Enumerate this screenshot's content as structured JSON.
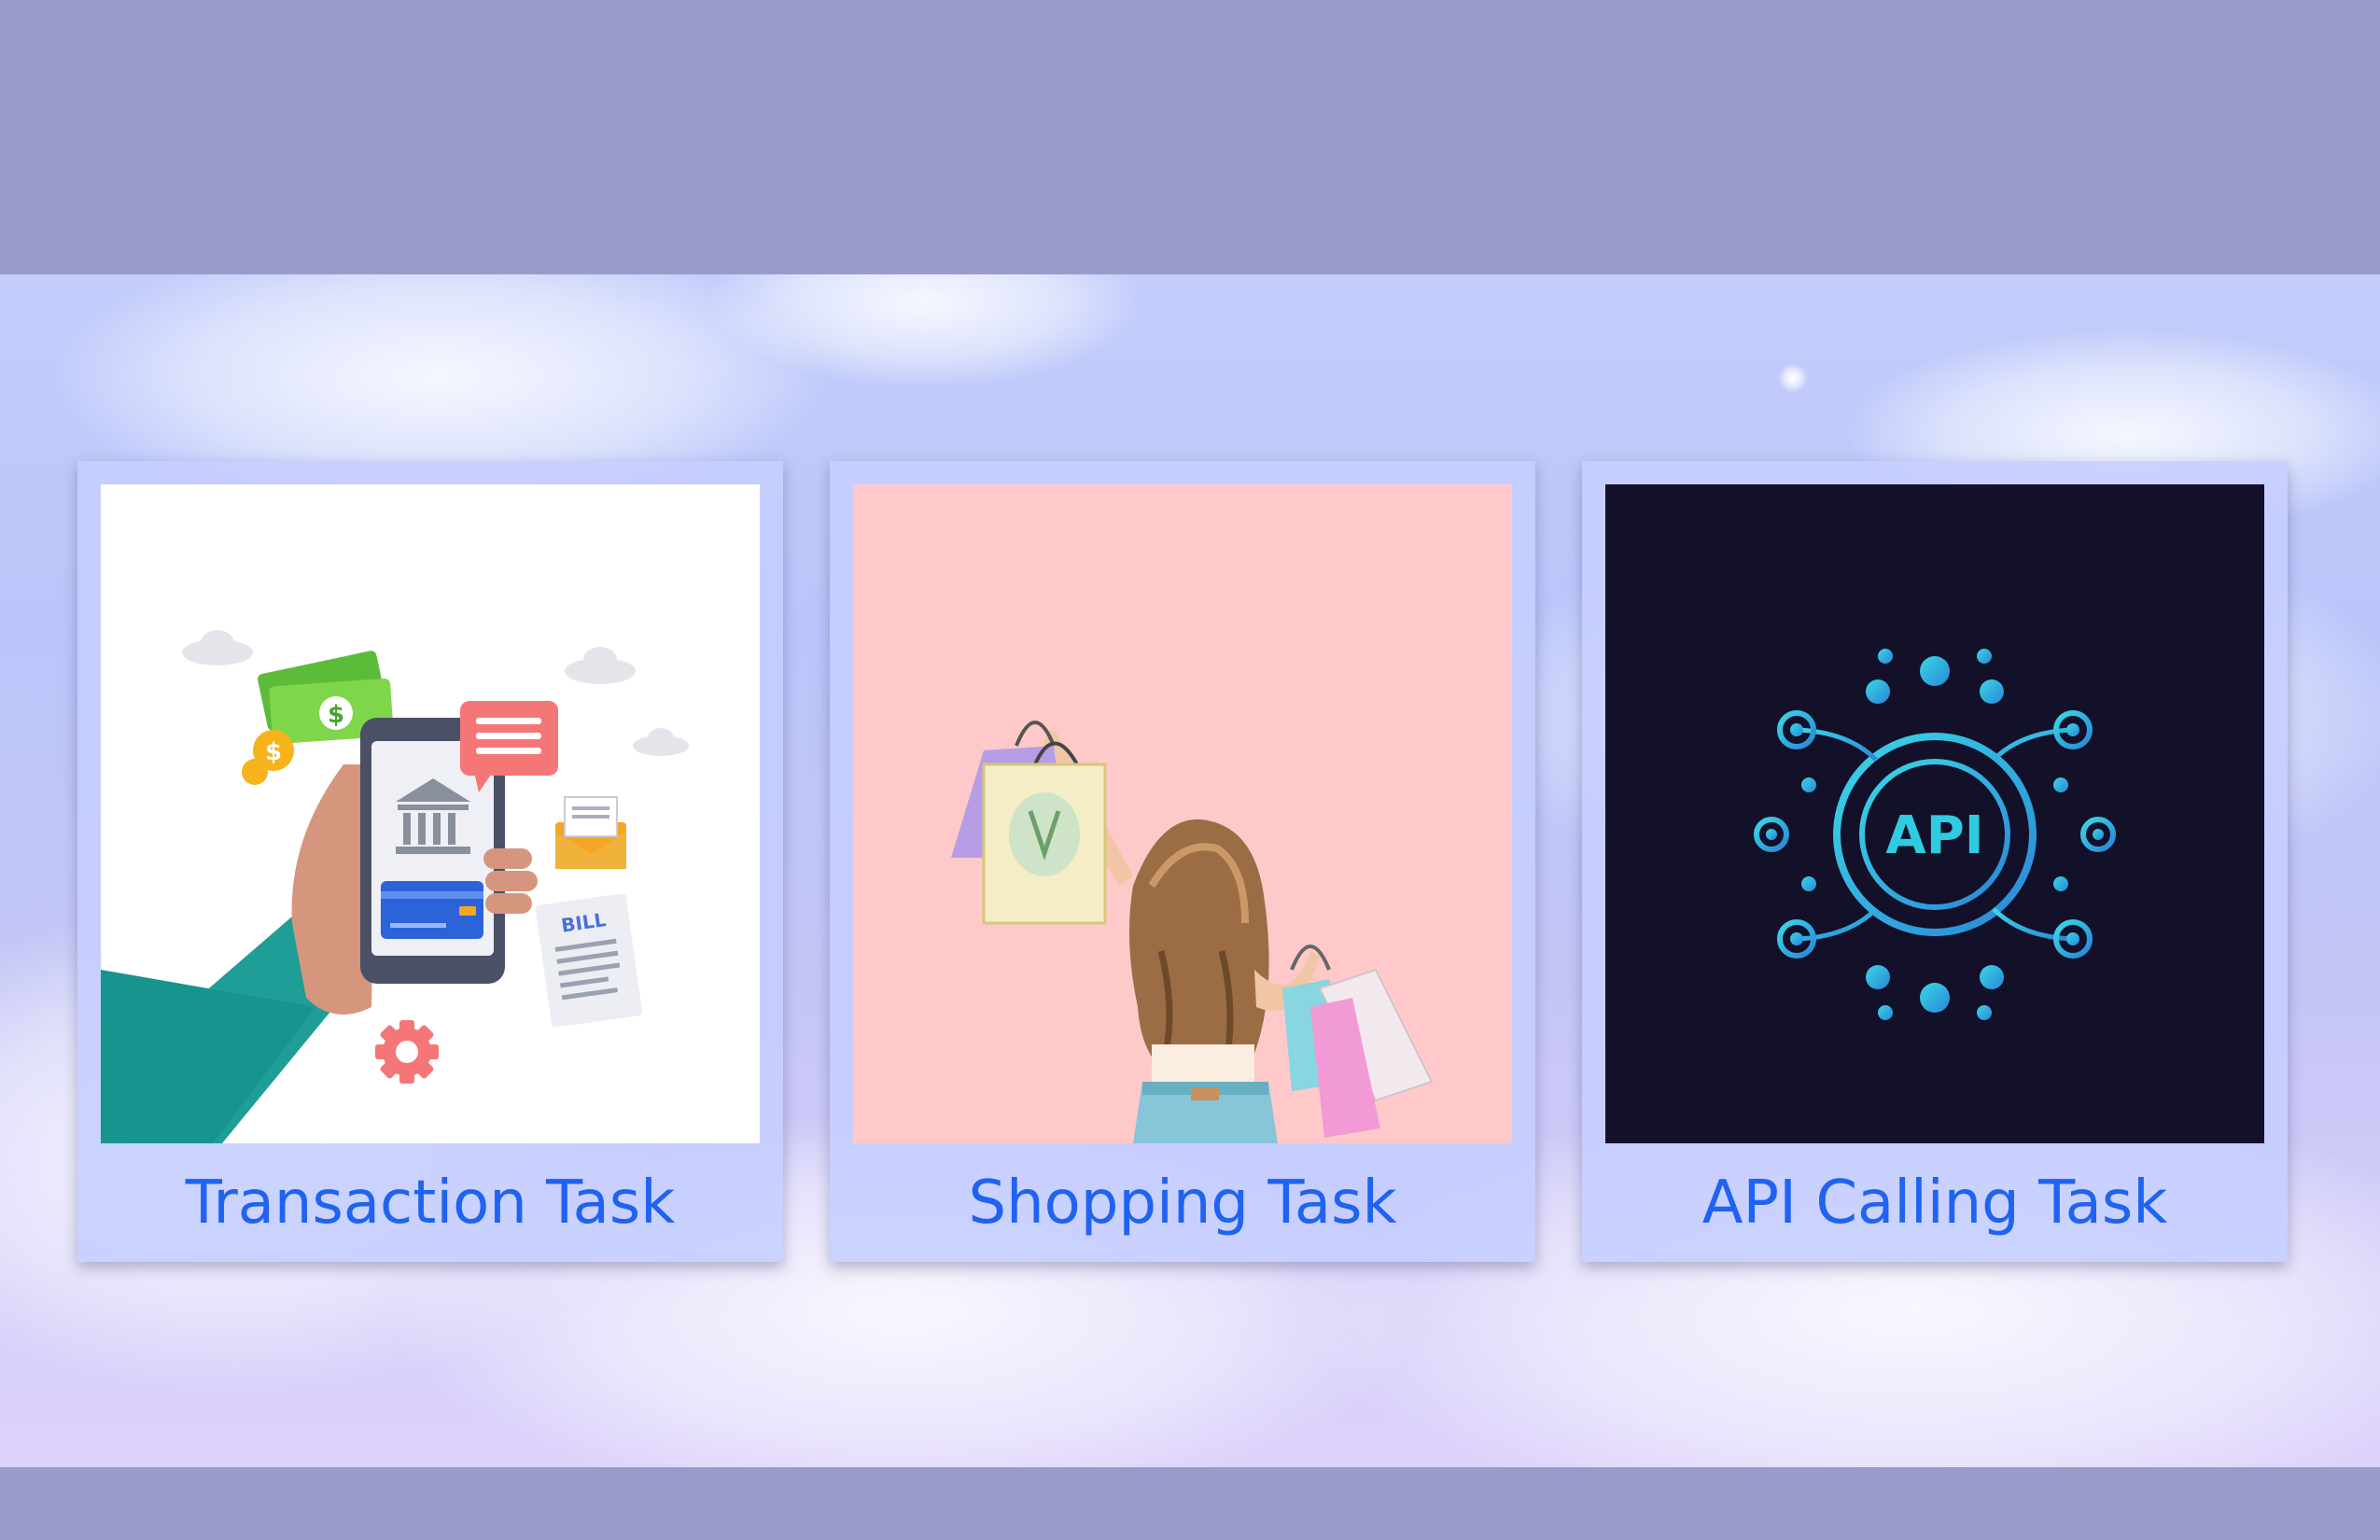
{
  "cards": [
    {
      "title": "Transaction Task",
      "image_icon": "mobile-banking-illustration",
      "image_text": "BILL"
    },
    {
      "title": "Shopping Task",
      "image_icon": "shopping-girl-illustration"
    },
    {
      "title": "API Calling Task",
      "image_icon": "api-network-illustration",
      "image_text": "API"
    }
  ],
  "colors": {
    "band": "#9a9acb",
    "card_title": "#1f63f0",
    "card_bg": "#c5ceff",
    "shopping_bg": "#ffc9c9",
    "api_bg": "#13102a",
    "api_glow": "#2bc8e8"
  }
}
